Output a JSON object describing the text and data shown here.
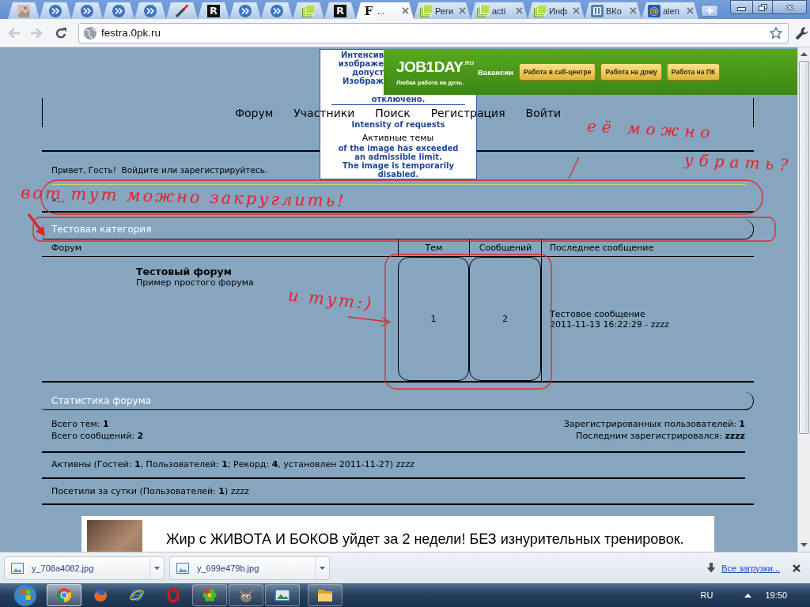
{
  "browser": {
    "tabs": [
      {
        "kind": "thumbnail",
        "selected": false
      },
      {
        "kind": "chevrons",
        "selected": false
      },
      {
        "kind": "chevrons",
        "selected": false
      },
      {
        "kind": "chevrons",
        "selected": false
      },
      {
        "kind": "chevrons",
        "selected": false
      },
      {
        "kind": "blade",
        "selected": false
      },
      {
        "kind": "letter-dark",
        "glyph": "R",
        "selected": false
      },
      {
        "kind": "chevrons",
        "selected": false
      },
      {
        "kind": "chevrons",
        "selected": false
      },
      {
        "kind": "squares",
        "selected": false
      },
      {
        "kind": "letter-dark",
        "glyph": "R",
        "selected": false
      },
      {
        "kind": "letter-light",
        "glyph": "F",
        "title": "...",
        "selected": true
      },
      {
        "kind": "squares",
        "title": "Реги",
        "selected": false
      },
      {
        "kind": "squares",
        "title": "acti",
        "selected": false
      },
      {
        "kind": "squares",
        "title": "Инф",
        "selected": false
      },
      {
        "kind": "bars",
        "title": "ВКо",
        "selected": false
      },
      {
        "kind": "letter-tile",
        "glyph": "@",
        "title": "alen",
        "selected": false
      }
    ],
    "back": {
      "disabled": true
    },
    "forward": {
      "disabled": true
    },
    "address": {
      "value": "festra.0pk.ru"
    }
  },
  "header": {
    "nav": [
      "Форум",
      "Участники",
      "Поиск",
      "Регистрация",
      "Войти"
    ],
    "active_topics": "Активные темы"
  },
  "error_image": {
    "lines_ru": [
      "Интенсив",
      "изображе",
      "допуст",
      "Изображ"
    ],
    "last_ru": "отключено.",
    "lines_en": [
      "Intensity of requests",
      "of the image has exceeded",
      "an admissible limit.",
      "The image is temporarily",
      "disabled."
    ]
  },
  "banner": {
    "logo": "JOB1DAY$^{.RU}$",
    "tagline": "Любая работа на день.",
    "label": "Вакансии",
    "buttons": [
      "Работа в call-центре",
      "Работа на дому",
      "Работа на ПК"
    ]
  },
  "greeting": "Привет, Гость!  Войдите или зарегистрируйтесь.",
  "breadcrumb": "»...",
  "category": {
    "title": "Тестовая категория",
    "columns": [
      "Форум",
      "Тем",
      "Сообщений",
      "Последнее сообщение"
    ],
    "forums": [
      {
        "name": "Тестовый форум",
        "description": "Пример простого форума",
        "topics": "1",
        "posts": "2",
        "last_post": {
          "title": "Тестовое сообщение",
          "meta": "2011-11-13 16:22:29 - zzzz"
        }
      }
    ]
  },
  "stats": {
    "title": "Статистика форума",
    "left": [
      "Всего тем: **1**",
      "Всего сообщений: **2**"
    ],
    "right": [
      "Зарегистрированных пользователей: **1**",
      "Последним зарегистрировался: **zzzz**"
    ],
    "online": "Активны (Гостей: **1**, Пользователей: **1**; Рекорд: **4**, установлен 2011-11-27) zzzz",
    "visited": "Посетили за сутки (Пользователей: **1**) zzzz"
  },
  "bottom_ad": {
    "text": "Жир с ЖИВОТА И БОКОВ уйдет за 2 недели! БЕЗ изнурительных тренировок."
  },
  "notes": [
    "её можно убрать?",
    "вот тут можно закруглить!",
    "и тут:)"
  ],
  "downloads": {
    "items": [
      "y_708a4082.jpg",
      "y_699e479b.jpg"
    ],
    "all_link": "Все загрузки..."
  },
  "taskbar": {
    "apps": [
      {
        "kind": "tricolor",
        "open": true,
        "selected": true
      },
      {
        "kind": "fox",
        "open": false,
        "selected": false
      },
      {
        "kind": "orbit",
        "open": false,
        "selected": false
      },
      {
        "kind": "ring",
        "open": false,
        "selected": false
      },
      {
        "kind": "flower",
        "open": true,
        "selected": false
      },
      {
        "kind": "mascot",
        "open": true,
        "selected": false
      },
      {
        "kind": "picture",
        "open": true,
        "selected": false
      },
      {
        "kind": "folder",
        "open": true,
        "selected": false
      }
    ],
    "language": "RU",
    "clock": "19:50"
  }
}
